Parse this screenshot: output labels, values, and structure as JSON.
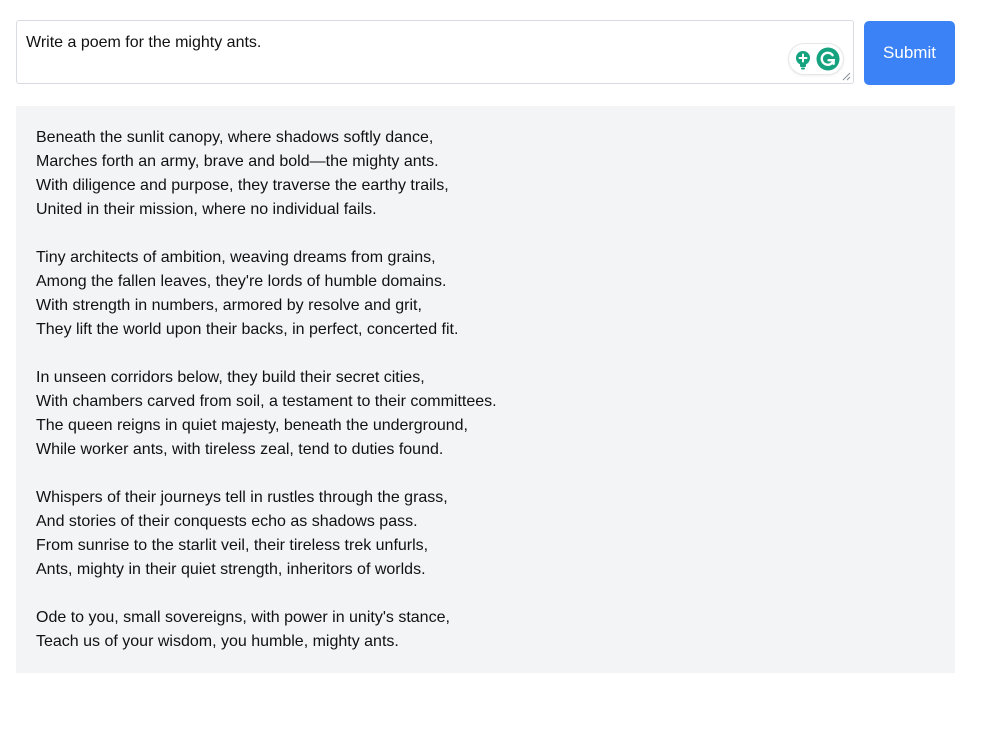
{
  "prompt": {
    "value": "Write a poem for the mighty ants."
  },
  "submit": {
    "label": "Submit"
  },
  "colors": {
    "submit_bg": "#3b82f6",
    "panel_bg": "#f3f4f6",
    "grammarly_green": "#15a37f"
  },
  "icons": {
    "assistant": "grammarly-icon",
    "suggestion": "lightbulb-icon"
  },
  "response": {
    "stanzas": [
      [
        "Beneath the sunlit canopy, where shadows softly dance,",
        "Marches forth an army, brave and bold—the mighty ants.",
        "With diligence and purpose, they traverse the earthy trails,",
        "United in their mission, where no individual fails."
      ],
      [
        "Tiny architects of ambition, weaving dreams from grains,",
        "Among the fallen leaves, they're lords of humble domains.",
        "With strength in numbers, armored by resolve and grit,",
        "They lift the world upon their backs, in perfect, concerted fit."
      ],
      [
        "In unseen corridors below, they build their secret cities,",
        "With chambers carved from soil, a testament to their committees.",
        "The queen reigns in quiet majesty, beneath the underground,",
        "While worker ants, with tireless zeal, tend to duties found."
      ],
      [
        "Whispers of their journeys tell in rustles through the grass,",
        "And stories of their conquests echo as shadows pass.",
        "From sunrise to the starlit veil, their tireless trek unfurls,",
        "Ants, mighty in their quiet strength, inheritors of worlds."
      ],
      [
        "Ode to you, small sovereigns, with power in unity's stance,",
        "Teach us of your wisdom, you humble, mighty ants."
      ]
    ]
  }
}
